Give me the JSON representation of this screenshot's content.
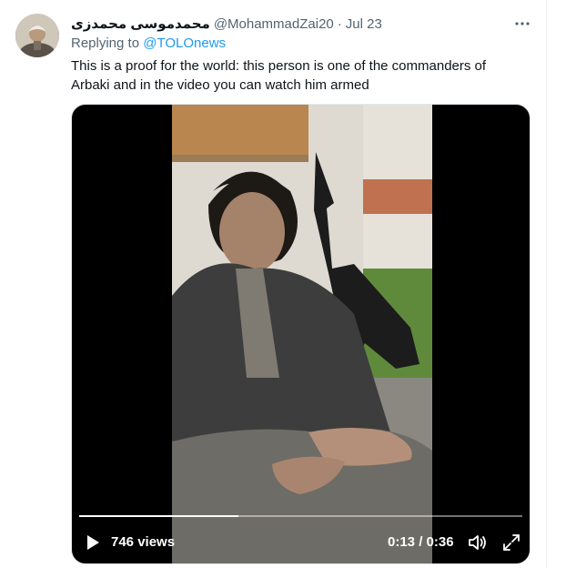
{
  "tweet": {
    "display_name": "محمدموسی محمدزی",
    "handle": "@MohammadZai20",
    "separator": "·",
    "date": "Jul 23",
    "replying_prefix": "Replying to",
    "replying_to": "@TOLOnews",
    "text": "This is a proof for the world: this person is one of the commanders of Arbaki and in the video you can watch him armed"
  },
  "video": {
    "views": "746 views",
    "time": "0:13 / 0:36",
    "progress": 0.36
  },
  "icons": {
    "more": "more-horizontal-icon",
    "play": "play-icon",
    "volume": "volume-icon",
    "fullscreen": "fullscreen-icon"
  },
  "colors": {
    "link": "#1d9bf0",
    "secondary_text": "#536471",
    "primary_text": "#0f1419"
  }
}
